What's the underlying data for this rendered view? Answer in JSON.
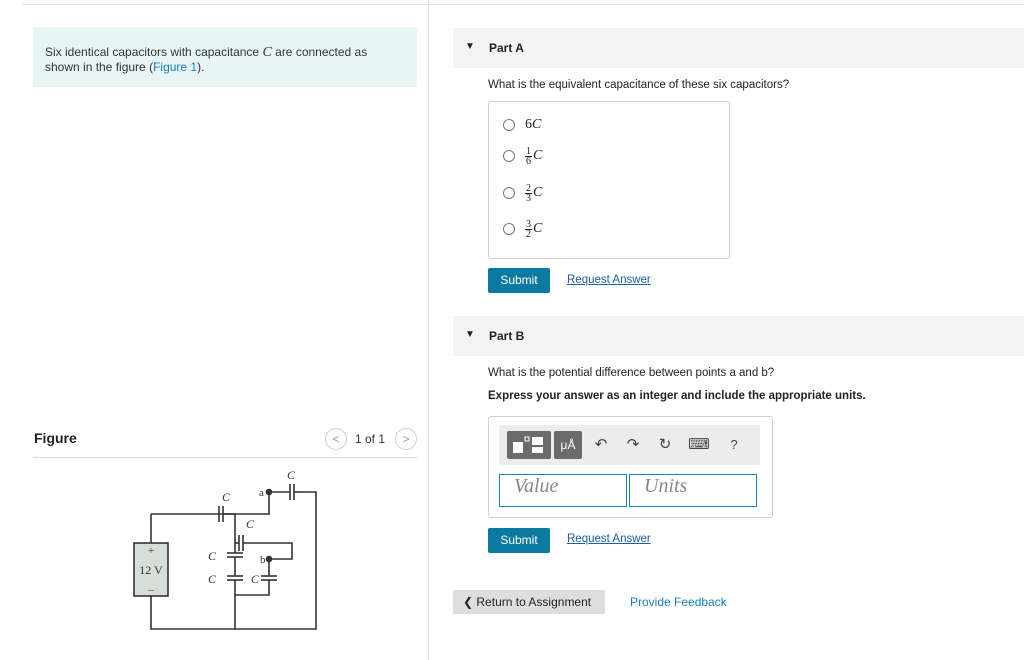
{
  "problem": {
    "text_before": "Six identical capacitors with capacitance",
    "symbol": "C",
    "text_after": "are connected as shown in the figure",
    "link": "Figure 1"
  },
  "figure": {
    "title": "Figure",
    "pager": "1 of 1",
    "prev_icon": "<",
    "next_icon": ">",
    "circuit": {
      "battery_label": "12 V",
      "plus": "+",
      "minus": "–",
      "cap_label": "C",
      "node_a": "a",
      "node_b": "b"
    }
  },
  "part_a": {
    "title": "Part A",
    "question": "What is the equivalent capacitance of these six capacitors?",
    "choices": [
      {
        "whole": "6",
        "var": "C"
      },
      {
        "num": "1",
        "den": "6",
        "var": "C"
      },
      {
        "num": "2",
        "den": "3",
        "var": "C"
      },
      {
        "num": "3",
        "den": "2",
        "var": "C"
      }
    ],
    "submit": "Submit",
    "request": "Request Answer"
  },
  "part_b": {
    "title": "Part B",
    "question": "What is the potential difference between points a and b?",
    "instruction": "Express your answer as an integer and include the appropriate units.",
    "toolbar": {
      "units_button": "μÅ",
      "undo_icon": "↶",
      "redo_icon": "↷",
      "reset_icon": "↻",
      "keyboard_icon": "⌨",
      "help": "?"
    },
    "value_placeholder": "Value",
    "units_placeholder": "Units",
    "submit": "Submit",
    "request": "Request Answer"
  },
  "footer": {
    "return": "❮ Return to Assignment",
    "feedback": "Provide Feedback"
  },
  "colors": {
    "accent": "#0a7aa0",
    "link": "#1a7fb8",
    "problem_bg": "#e8f5f5"
  }
}
